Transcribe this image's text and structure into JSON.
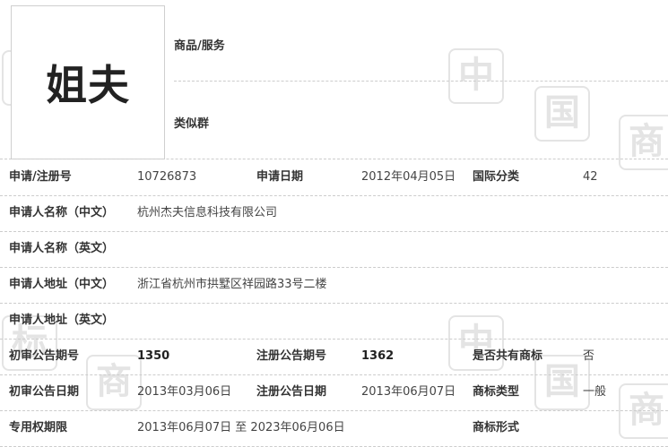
{
  "trademark": {
    "logo_text": "姐夫",
    "goods_services_label": "商品/服务",
    "similar_group_label": "类似群"
  },
  "watermark": {
    "glyphs": [
      "中",
      "国",
      "商",
      "标"
    ]
  },
  "rows": [
    [
      {
        "label": "申请/注册号",
        "value": "10726873"
      },
      {
        "label": "申请日期",
        "value": "2012年04月05日"
      },
      {
        "label": "国际分类",
        "value": "42"
      }
    ],
    [
      {
        "label": "申请人名称（中文）",
        "value": "杭州杰夫信息科技有限公司"
      }
    ],
    [
      {
        "label": "申请人名称（英文）",
        "value": ""
      }
    ],
    [
      {
        "label": "申请人地址（中文）",
        "value": "浙江省杭州市拱墅区祥园路33号二楼"
      }
    ],
    [
      {
        "label": "申请人地址（英文）",
        "value": ""
      }
    ],
    [
      {
        "label": "初审公告期号",
        "value": "1350"
      },
      {
        "label": "注册公告期号",
        "value": "1362"
      },
      {
        "label": "是否共有商标",
        "value": "否"
      }
    ],
    [
      {
        "label": "初审公告日期",
        "value": "2013年03月06日"
      },
      {
        "label": "注册公告日期",
        "value": "2013年06月07日"
      },
      {
        "label": "商标类型",
        "value": "一般"
      }
    ],
    [
      {
        "label": "专用权期限",
        "value": "2013年06月07日 至 2023年06月06日"
      },
      {
        "label": "商标形式",
        "value": ""
      }
    ]
  ]
}
